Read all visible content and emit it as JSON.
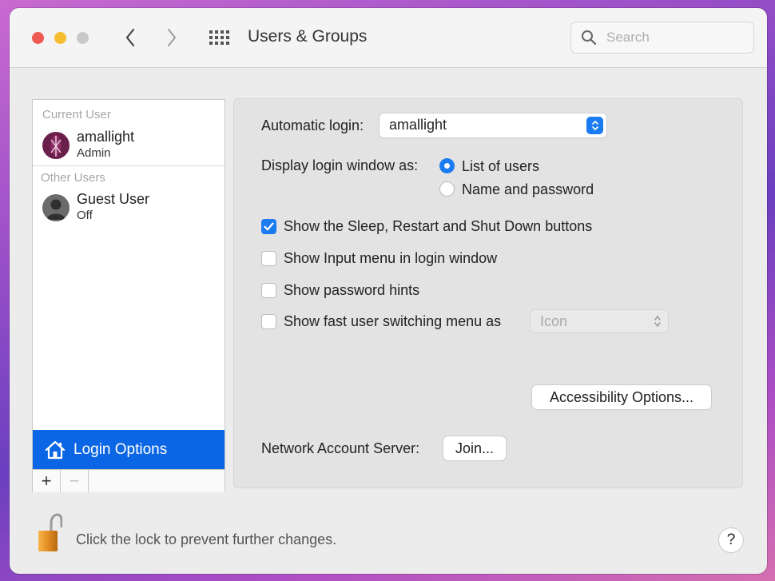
{
  "window": {
    "title": "Users & Groups"
  },
  "search": {
    "placeholder": "Search"
  },
  "sidebar": {
    "current_user_label": "Current User",
    "current_user": {
      "name": "amallight",
      "role": "Admin"
    },
    "other_users_label": "Other Users",
    "other_users": [
      {
        "name": "Guest User",
        "role": "Off"
      }
    ],
    "login_options_label": "Login Options",
    "add_label": "+",
    "remove_label": "−"
  },
  "login": {
    "automatic_login_label": "Automatic login:",
    "automatic_login_value": "amallight",
    "display_as_label": "Display login window as:",
    "display_options": [
      {
        "label": "List of users",
        "selected": true
      },
      {
        "label": "Name and password",
        "selected": false
      }
    ],
    "checkboxes": [
      {
        "label": "Show the Sleep, Restart and Shut Down buttons",
        "checked": true
      },
      {
        "label": "Show Input menu in login window",
        "checked": false
      },
      {
        "label": "Show password hints",
        "checked": false
      },
      {
        "label": "Show fast user switching menu as",
        "checked": false
      }
    ],
    "fast_switch_value": "Icon",
    "accessibility_button": "Accessibility Options...",
    "network_label": "Network Account Server:",
    "join_button": "Join..."
  },
  "footer": {
    "lock_text": "Click the lock to prevent further changes.",
    "help_label": "?"
  },
  "colors": {
    "accent": "#1b7cf1",
    "selection": "#0a66e4"
  }
}
